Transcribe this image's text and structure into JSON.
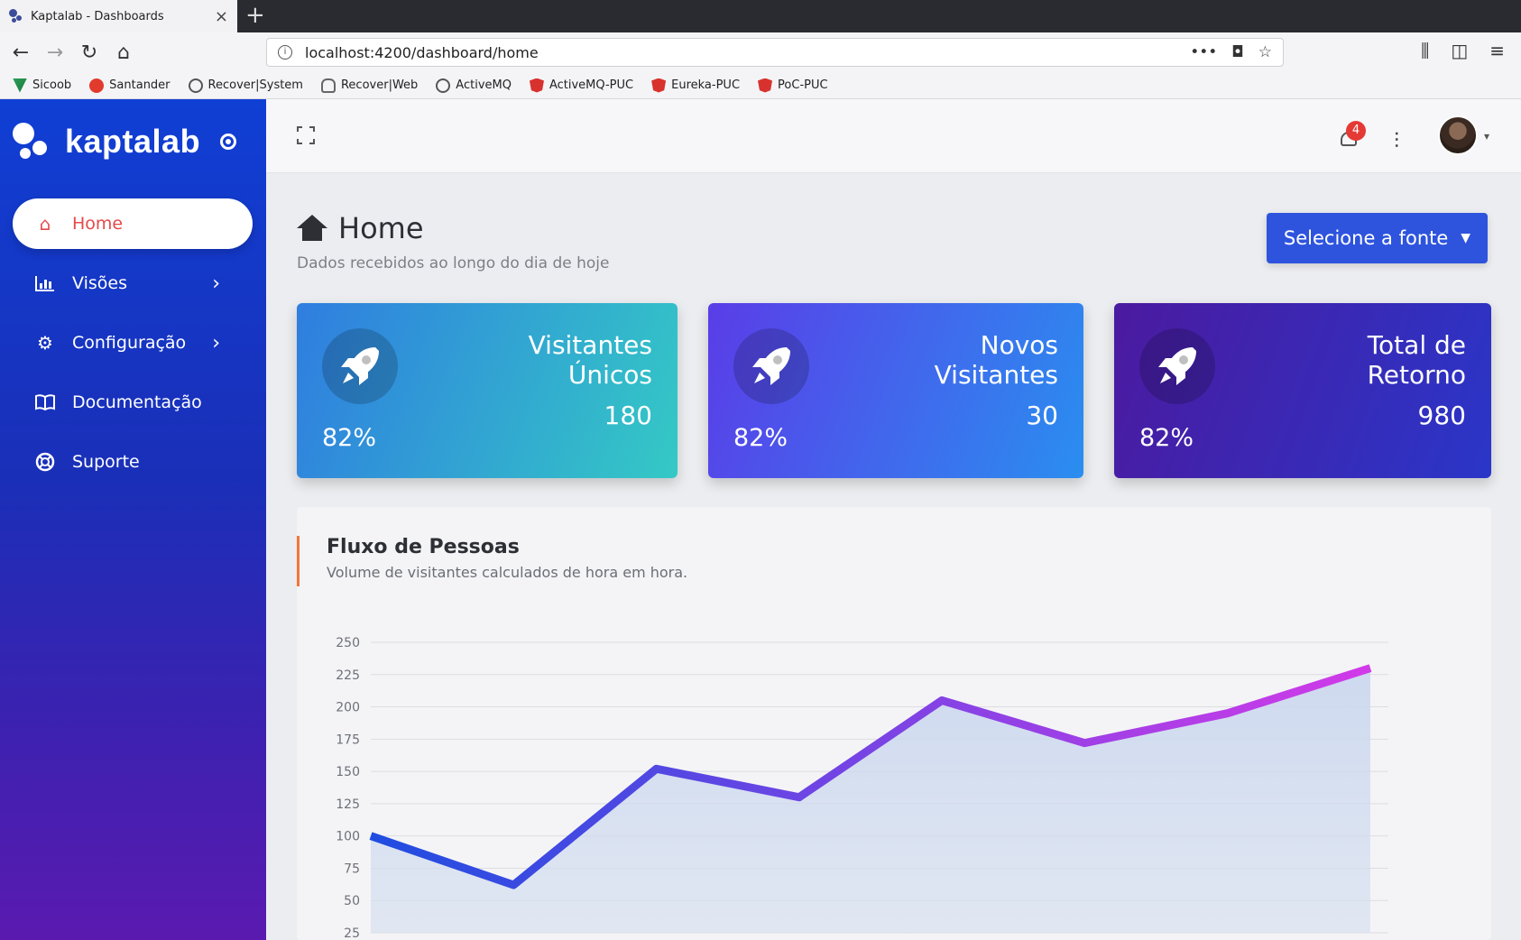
{
  "browser": {
    "tab_title": "Kaptalab - Dashboards",
    "tab_close": "×",
    "new_tab": "+",
    "url": "localhost:4200/dashboard/home",
    "bookmarks": [
      "Sicoob",
      "Santander",
      "Recover|System",
      "Recover|Web",
      "ActiveMQ",
      "ActiveMQ-PUC",
      "Eureka-PUC",
      "PoC-PUC"
    ]
  },
  "brand": {
    "name": "kaptalab"
  },
  "sidebar": {
    "items": [
      {
        "label": "Home",
        "icon": "home-icon"
      },
      {
        "label": "Visões",
        "icon": "chart-icon",
        "chevron": "›"
      },
      {
        "label": "Configuração",
        "icon": "gear-icon",
        "chevron": "›"
      },
      {
        "label": "Documentação",
        "icon": "book-icon"
      },
      {
        "label": "Suporte",
        "icon": "lifebuoy-icon"
      }
    ]
  },
  "topbar": {
    "notification_count": "4"
  },
  "page": {
    "title": "Home",
    "subtitle": "Dados recebidos ao longo do dia de hoje",
    "source_button": "Selecione a fonte"
  },
  "cards": [
    {
      "label_line1": "Visitantes",
      "label_line2": "Únicos",
      "value": "180",
      "percent": "82%",
      "gradient": [
        "#2f7de0",
        "#34c9c5"
      ]
    },
    {
      "label_line1": "Novos",
      "label_line2": "Visitantes",
      "value": "30",
      "percent": "82%",
      "gradient": [
        "#5a3de8",
        "#2a8ef0"
      ]
    },
    {
      "label_line1": "Total de",
      "label_line2": "Retorno",
      "value": "980",
      "percent": "82%",
      "gradient": [
        "#4b1aa0",
        "#2a36c8"
      ]
    }
  ],
  "chart": {
    "title": "Fluxo de Pessoas",
    "subtitle": "Volume de visitantes calculados de hora em hora."
  },
  "chart_data": {
    "type": "area",
    "x": [
      0,
      1,
      2,
      3,
      4,
      5,
      6,
      7
    ],
    "series": [
      {
        "values": [
          100,
          62,
          152,
          130,
          205,
          172,
          195,
          230
        ]
      }
    ],
    "yticks": [
      25,
      50,
      75,
      100,
      125,
      150,
      175,
      200,
      225,
      250
    ],
    "ylim": [
      25,
      250
    ],
    "grid": true,
    "colors": {
      "line_start": "#1f4de0",
      "line_end": "#d23ae8"
    }
  }
}
